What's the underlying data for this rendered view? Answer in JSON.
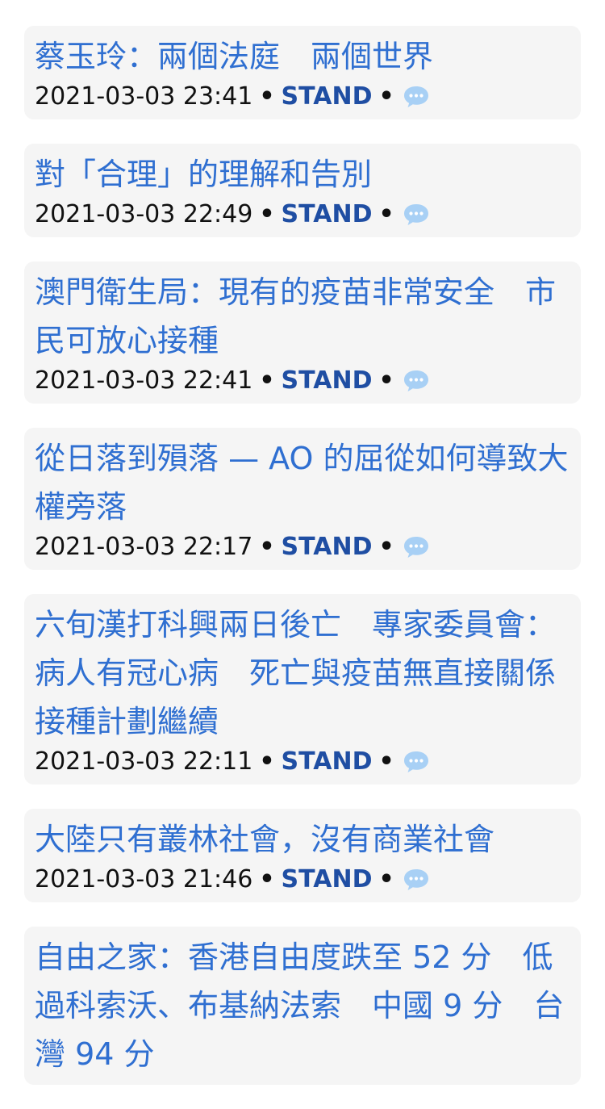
{
  "colors": {
    "title": "#2f6fd1",
    "source": "#1f4ea3",
    "card_bg": "#f5f5f5",
    "comment_icon": "#a8d0f5"
  },
  "icons": {
    "comment": "speech-bubble-icon"
  },
  "articles": [
    {
      "title": "蔡玉玲：兩個法庭　兩個世界",
      "timestamp": "2021-03-03 23:41",
      "separator": "•",
      "source": "STAND"
    },
    {
      "title": "對「合理」的理解和告別",
      "timestamp": "2021-03-03 22:49",
      "separator": "•",
      "source": "STAND"
    },
    {
      "title": "澳門衛生局：現有的疫苗非常安全　市民可放心接種",
      "timestamp": "2021-03-03 22:41",
      "separator": "•",
      "source": "STAND"
    },
    {
      "title": "從日落到殞落 — AO 的屈從如何導致大權旁落",
      "timestamp": "2021-03-03 22:17",
      "separator": "•",
      "source": "STAND"
    },
    {
      "title": "六旬漢打科興兩日後亡　專家委員會：病人有冠心病　死亡與疫苗無直接關係　接種計劃繼續",
      "timestamp": "2021-03-03 22:11",
      "separator": "•",
      "source": "STAND"
    },
    {
      "title": "大陸只有叢林社會，沒有商業社會",
      "timestamp": "2021-03-03 21:46",
      "separator": "•",
      "source": "STAND"
    },
    {
      "title": "自由之家：香港自由度跌至 52 分　低過科索沃、布基納法索　中國 9 分　台灣 94 分",
      "timestamp": "",
      "separator": "",
      "source": ""
    }
  ]
}
